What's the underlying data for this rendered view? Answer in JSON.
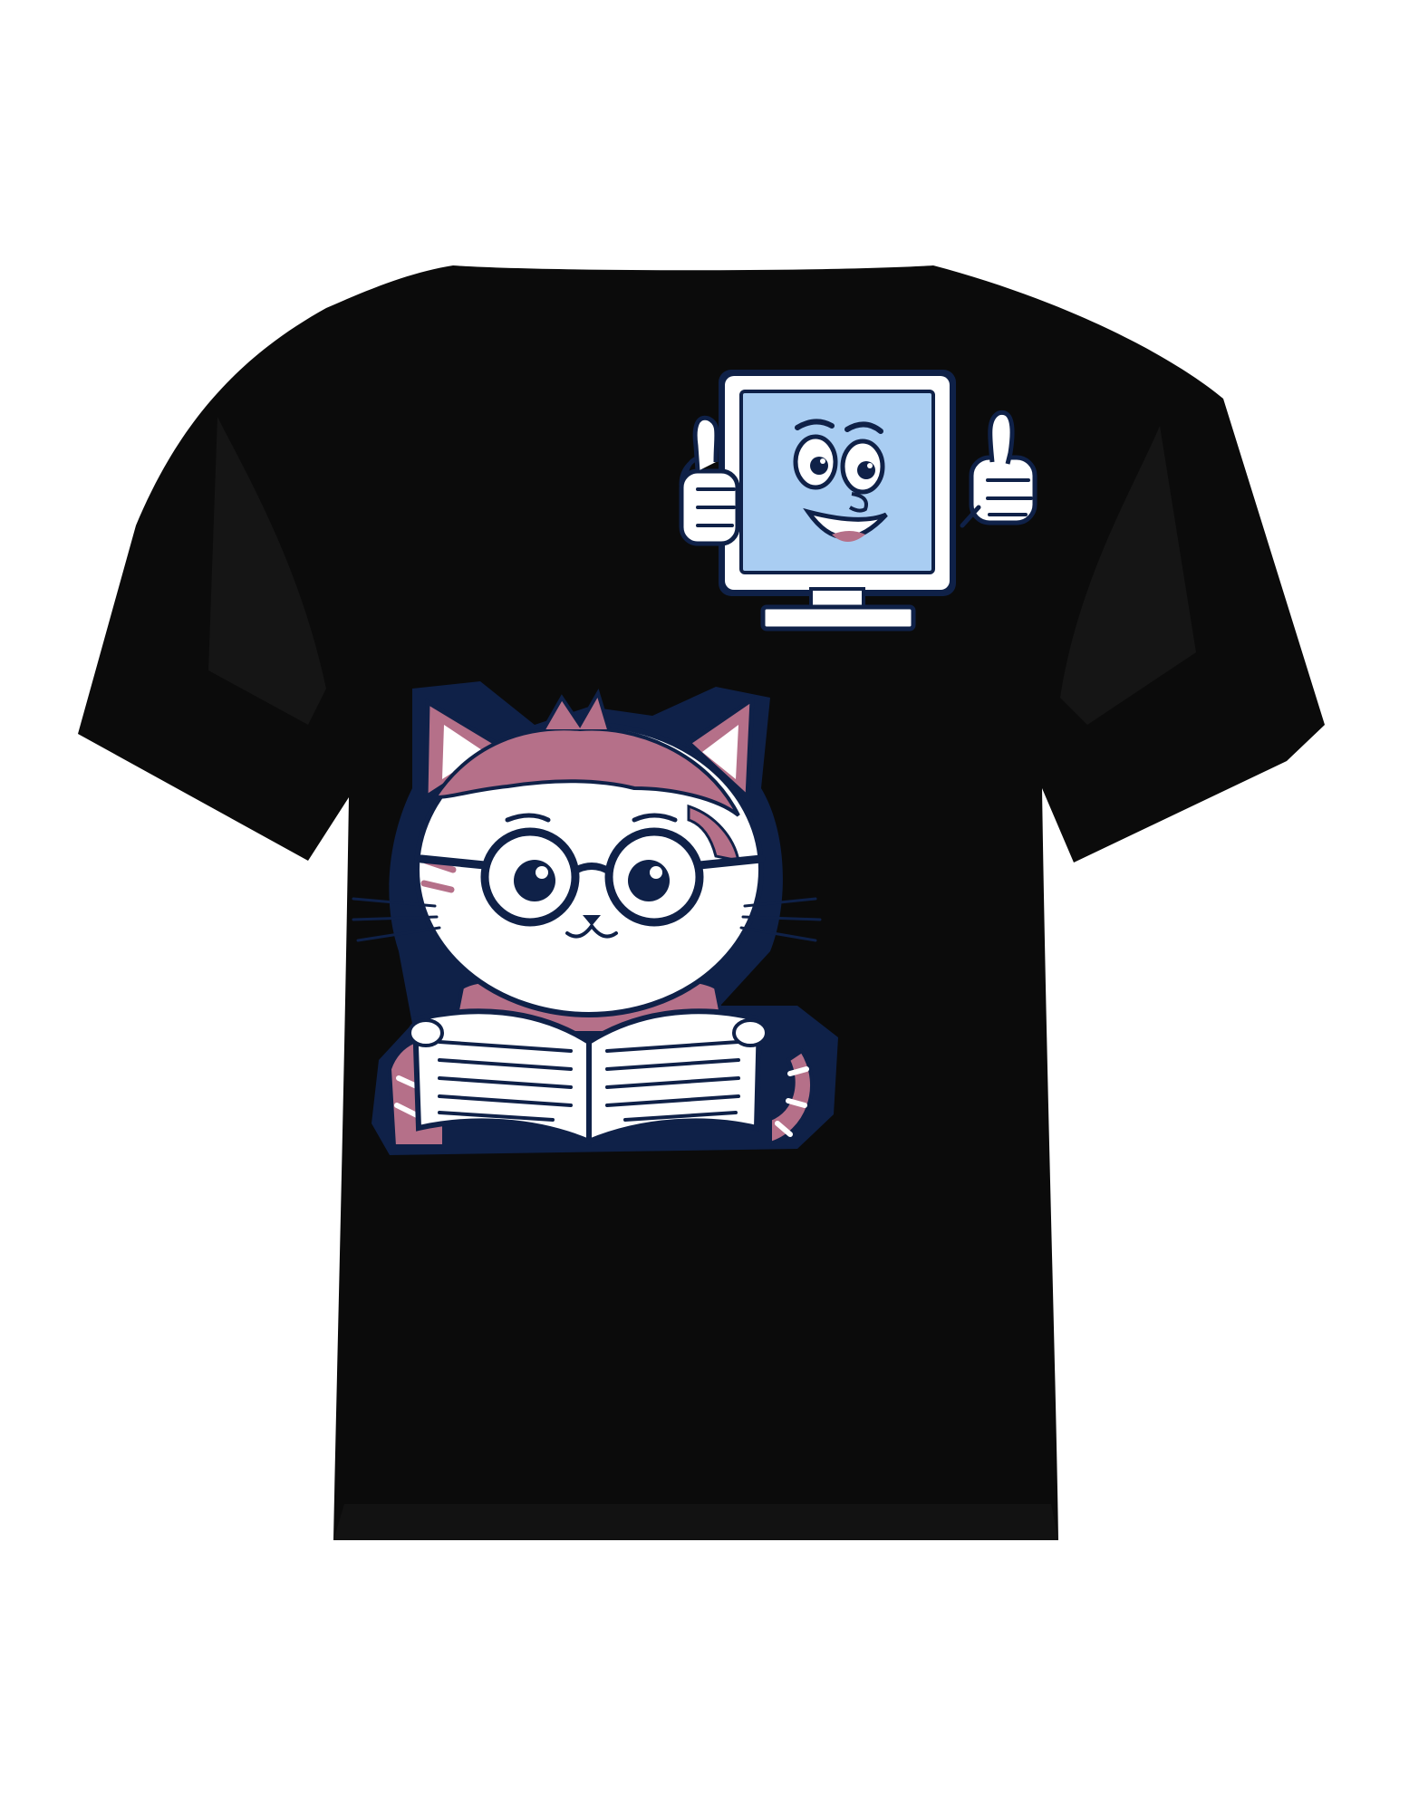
{
  "scene": {
    "subject": "tshirt-back",
    "colors": {
      "background": "#ffffff",
      "shirt": "#0b0b0b",
      "shirt_shade": "#161616",
      "outline_navy": "#0f2148",
      "monitor_screen": "#a9cdf2",
      "monitor_frame": "#ffffff",
      "cat_fur_accent": "#b57089",
      "cat_white": "#ffffff",
      "glasses": "#0f2148"
    },
    "graphics": [
      {
        "name": "smiling-monitor-mascot",
        "details": [
          "thumbs-up-left",
          "thumbs-up-right",
          "stand"
        ]
      },
      {
        "name": "cat-with-glasses-reading-book",
        "details": [
          "round-glasses",
          "open-book",
          "striped-tail"
        ]
      }
    ]
  }
}
